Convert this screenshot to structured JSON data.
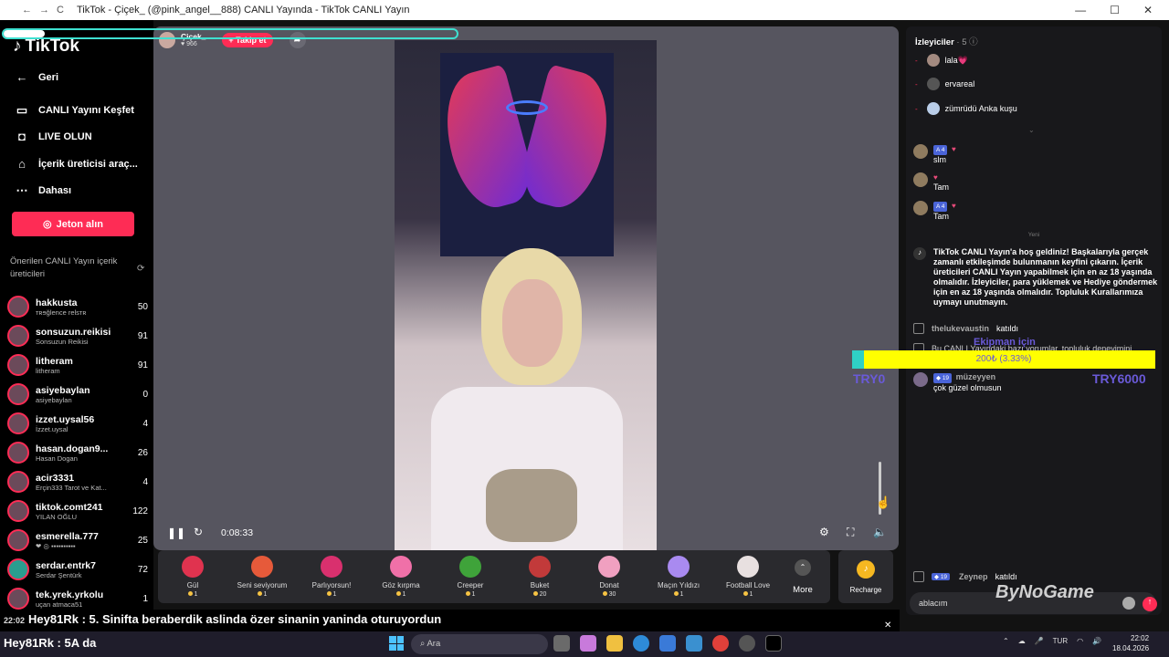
{
  "window": {
    "title": "TikTok - Çiçek_ (@pink_angel__888) CANLI Yayında - TikTok CANLI Yayın",
    "back": "←",
    "forward": "→",
    "reload": "C",
    "minimize": "—",
    "maximize": "☐",
    "close": "✕"
  },
  "sidebar": {
    "logo": "TikTok",
    "nav": [
      {
        "label": "Geri",
        "icon": "back-arrow-icon"
      },
      {
        "label": "CANLI Yayını Keşfet",
        "icon": "live-tv-icon"
      },
      {
        "label": "LIVE OLUN",
        "icon": "camera-icon"
      },
      {
        "label": "İçerik üreticisi araç...",
        "icon": "creator-tools-icon"
      },
      {
        "label": "Dahası",
        "icon": "more-dots-icon"
      }
    ],
    "jeton_button": "Jeton alın",
    "suggested_title": "Önerilen CANLI Yayın içerik üreticileri",
    "suggested": [
      {
        "name": "hakkusta",
        "sub": "ᴛʀɘğlence relsᴛʀ",
        "count": "50"
      },
      {
        "name": "sonsuzun.reikisi",
        "sub": "Sonsuzun Reikisi",
        "count": "91"
      },
      {
        "name": "litheram",
        "sub": "litheram",
        "count": "91"
      },
      {
        "name": "asiyebaylan",
        "sub": "asiyebaylan",
        "count": "0"
      },
      {
        "name": "izzet.uysal56",
        "sub": "İzzet.uysal",
        "count": "4"
      },
      {
        "name": "hasan.dogan9...",
        "sub": "Hasan Dogan",
        "count": "26"
      },
      {
        "name": "acir3331",
        "sub": "Erçin333 Tarot ve Kat...",
        "count": "4"
      },
      {
        "name": "tiktok.comt241",
        "sub": "YILAN OĞLU",
        "count": "122"
      },
      {
        "name": "esmerella.777",
        "sub": "❤︎ ◎ ▪▪▪▪▪▪▪▪▪▪",
        "count": "25"
      },
      {
        "name": "serdar.entrk7",
        "sub": "Serdar Şentürk",
        "count": "72"
      },
      {
        "name": "tek.yrek.yrkolu",
        "sub": "uçan atmaca51",
        "count": "1"
      }
    ]
  },
  "player": {
    "streamer_name": "Çiçek_",
    "likes": "966",
    "follow_label": "+ Takip et",
    "time": "0:08:33",
    "progress_fraction": 0.09
  },
  "gifts": [
    {
      "name": "Gül",
      "price": "1",
      "color": "#e0334f"
    },
    {
      "name": "Seni seviyorum",
      "price": "1",
      "color": "#e65a3a"
    },
    {
      "name": "Parlıyorsun!",
      "price": "1",
      "color": "#d9306e"
    },
    {
      "name": "Göz kırpma",
      "price": "1",
      "color": "#f070a8"
    },
    {
      "name": "Creeper",
      "price": "1",
      "color": "#3fa33a"
    },
    {
      "name": "Buket",
      "price": "20",
      "color": "#c23a3a"
    },
    {
      "name": "Donat",
      "price": "30",
      "color": "#f0a0c0"
    },
    {
      "name": "Maçın Yıldızı",
      "price": "1",
      "color": "#a98af0"
    },
    {
      "name": "Football Love",
      "price": "1",
      "color": "#e8e0e0"
    }
  ],
  "more_label": "More",
  "recharge_label": "Recharge",
  "chat": {
    "viewers_title": "İzleyiciler",
    "viewers_count": "· 5",
    "viewers": [
      {
        "name": "lala💗"
      },
      {
        "name": "ervareal"
      },
      {
        "name": "zümrüdü Anka kuşu"
      }
    ],
    "messages": [
      {
        "badge": "4",
        "text": "slm"
      },
      {
        "badge": "",
        "text": "Tam"
      },
      {
        "badge": "4",
        "text": "Tam"
      }
    ],
    "new_label": "Yeni",
    "system_message": "TikTok CANLI Yayın'a hoş geldiniz! Başkalarıyla gerçek zamanlı etkileşimde bulunmanın keyfini çıkarın. İçerik üreticileri CANLI Yayın yapabilmek için en az 18 yaşında olmalıdır. İzleyiciler, para yüklemek ve Hediye göndermek için en az 18 yaşında olmalıdır. Topluluk Kurallarımıza uymayı unutmayın.",
    "join1_user": "thelukevaustin",
    "join_label": "katıldı",
    "partial_message": "Bu CANLI Yayındaki bazı yorumlar, topluluk deneyimini",
    "msg_user": "müzeyyen",
    "msg_badge": "19",
    "msg_text": "çok güzel olmusun",
    "join2_user": "Zeynep",
    "join2_badge": "19",
    "input_value": "ablacım"
  },
  "goal": {
    "title": "Ekipman için",
    "progress_text": "200₺ (3.33%)",
    "fraction": 0.0333,
    "min": "TRY0",
    "max": "TRY6000"
  },
  "overlay": {
    "line1_time": "22:02",
    "line1": "Hey81Rk : 5. Sinifta beraberdik aslinda özer sinanin yaninda oturuyordun",
    "line2": "Hey81Rk : 5A da",
    "watermark": "ByNoGame"
  },
  "taskbar": {
    "search_placeholder": "Ara",
    "lang": "TUR",
    "time": "22:02",
    "date": "18.04.2026"
  },
  "colors": {
    "accent": "#fe2c55",
    "goal_yellow": "#ffff00",
    "goal_text": "#6a5ad8"
  }
}
